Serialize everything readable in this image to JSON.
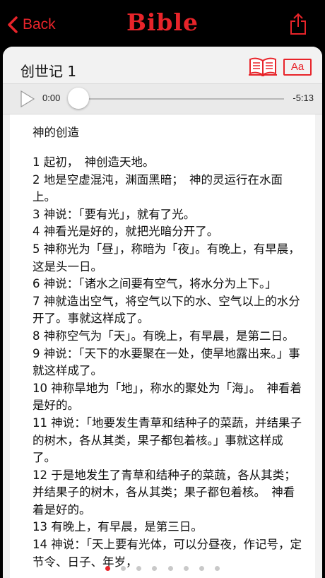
{
  "nav": {
    "back_label": "Back",
    "title": "Bible"
  },
  "chapter": {
    "name": "创世记 1",
    "font_button_label": "Aa"
  },
  "player": {
    "current_time": "0:00",
    "remaining_time": "-5:13",
    "progress": 0
  },
  "content": {
    "section_title": "神的创造",
    "verses": [
      "1 起初，　神创造天地。",
      "2 地是空虚混沌，渊面黑暗；　神的灵运行在水面上。",
      "3 神说：「要有光」，就有了光。",
      "4 神看光是好的，就把光暗分开了。",
      "5 神称光为「昼」，称暗为「夜」。有晚上，有早晨，这是头一日。",
      "6 神说：「诸水之间要有空气，将水分为上下。」",
      "7 神就造出空气，将空气以下的水、空气以上的水分开了。事就这样成了。",
      "8 神称空气为「天」。有晚上，有早晨，是第二日。",
      "9 神说：「天下的水要聚在一处，使旱地露出来。」事就这样成了。",
      "10 神称旱地为「地」，称水的聚处为「海」。　神看着是好的。",
      "11 神说：「地要发生青草和结种子的菜蔬，并结果子的树木，各从其类，果子都包着核。」事就这样成了。",
      "12 于是地发生了青草和结种子的菜蔬，各从其类；并结果子的树木，各从其类；果子都包着核。　神看着是好的。",
      "13 有晚上，有早晨，是第三日。",
      "14 神说：「天上要有光体，可以分昼夜，作记号，定节令、日子、年岁，"
    ]
  },
  "pagination": {
    "page_count": 8,
    "active_index": 0
  },
  "colors": {
    "accent": "#e8242a",
    "background": "#000000",
    "card": "#f2f2f2",
    "slider": "#1e7cf2"
  }
}
